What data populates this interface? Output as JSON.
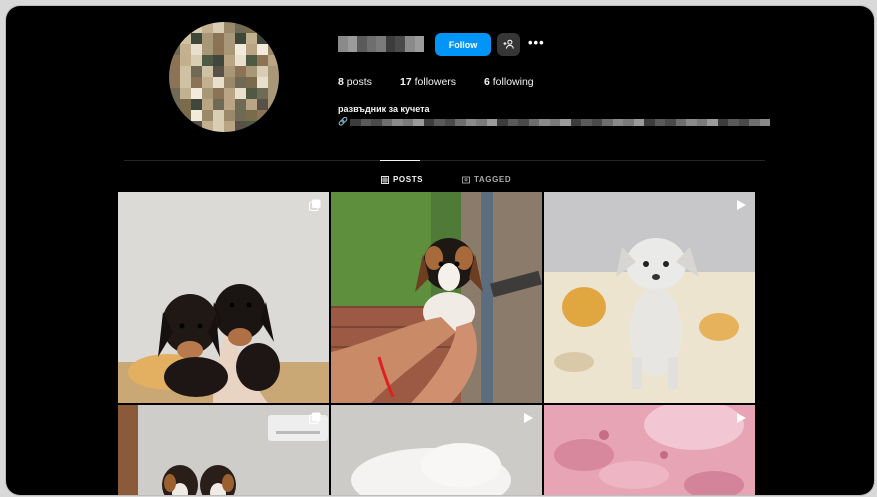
{
  "profile": {
    "follow_label": "Follow",
    "more_label": "•••",
    "posts_count": "8",
    "posts_label": "posts",
    "followers_count": "17",
    "followers_label": "followers",
    "following_count": "6",
    "following_label": "following",
    "bio_name": "развъдник за кучета"
  },
  "tabs": [
    {
      "label": "POSTS",
      "icon": "grid-icon",
      "active": true
    },
    {
      "label": "TAGGED",
      "icon": "tag-icon",
      "active": false
    }
  ],
  "posts": [
    {
      "kind": "carousel",
      "subject": "two dachshund puppies held by hand"
    },
    {
      "kind": "image",
      "subject": "beagle puppy held by hands outdoors"
    },
    {
      "kind": "reel",
      "subject": "white chihuahua puppy on blanket"
    },
    {
      "kind": "carousel",
      "subject": "beagle puppies indoors"
    },
    {
      "kind": "reel",
      "subject": "white fluffy puppy"
    },
    {
      "kind": "reel",
      "subject": "puppy on pink floral blanket"
    }
  ],
  "colors": {
    "background": "#000000",
    "follow_button": "#0095f6",
    "secondary_button": "#363636",
    "text_primary": "#f5f5f5",
    "text_secondary": "#a8a8a8"
  }
}
